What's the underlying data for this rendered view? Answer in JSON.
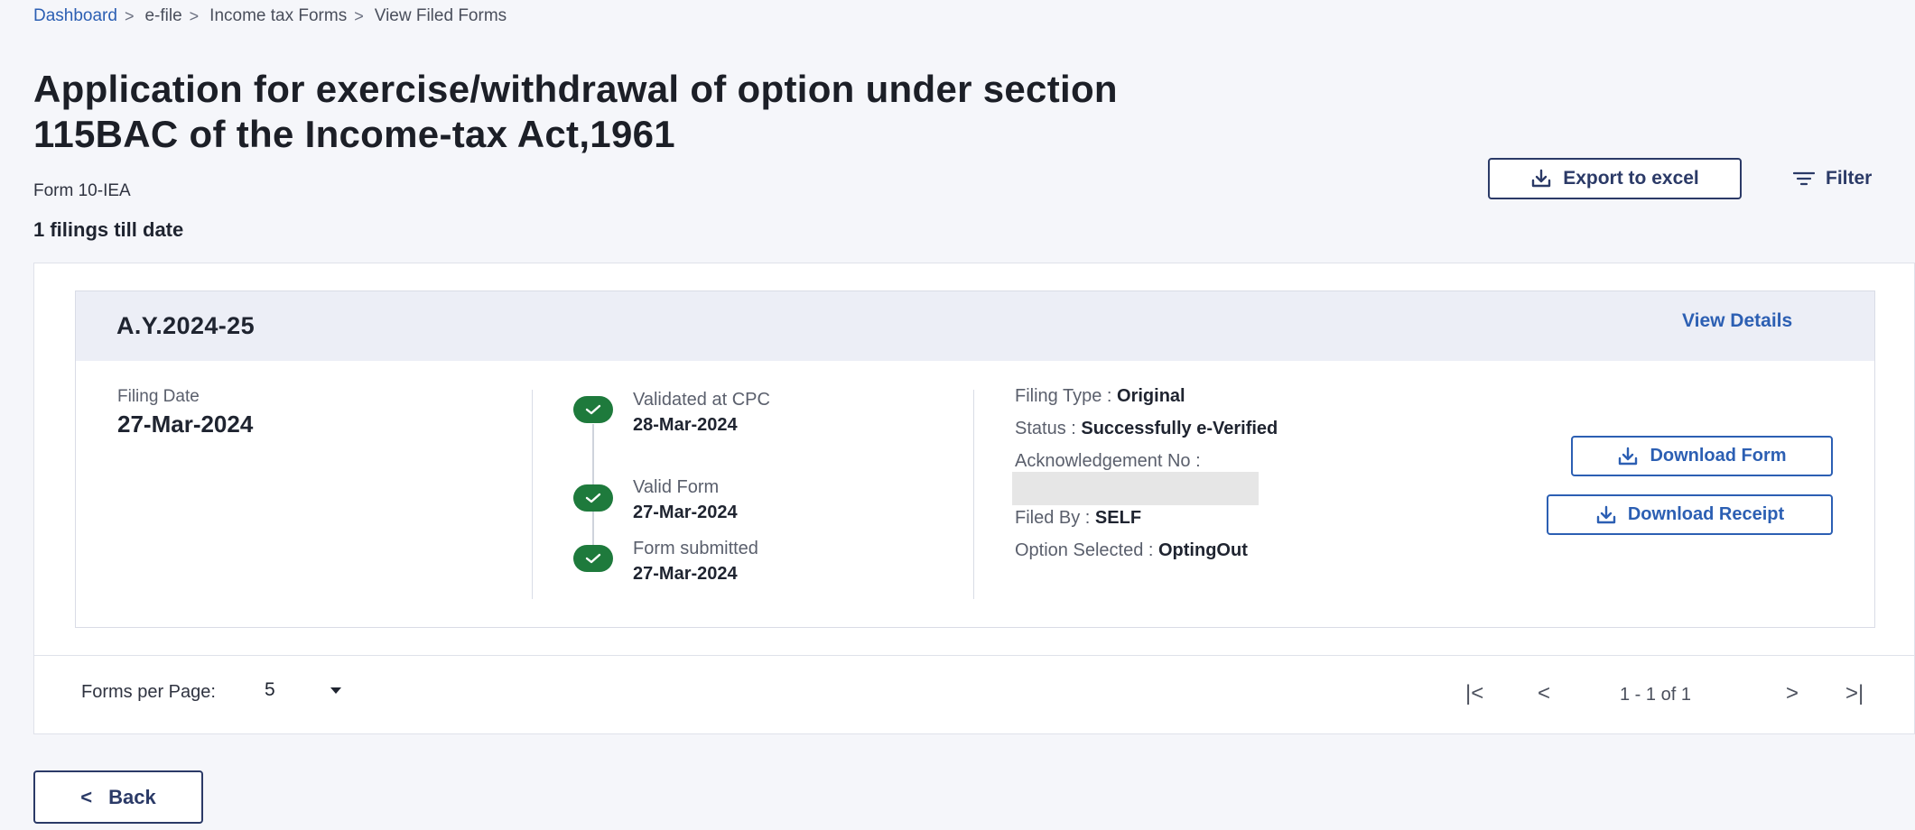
{
  "breadcrumb": {
    "items": [
      "Dashboard",
      "e-file",
      "Income tax Forms",
      "View Filed Forms"
    ],
    "separator": ">"
  },
  "page": {
    "title": "Application for exercise/withdrawal of option under section 115BAC of the Income-tax Act,1961",
    "form_name": "Form 10-IEA",
    "filings_count": "1 filings till date"
  },
  "toolbar": {
    "export_label": "Export to excel",
    "filter_label": "Filter"
  },
  "card": {
    "assessment_year": "A.Y.2024-25",
    "view_details_label": "View Details",
    "filing_date_label": "Filing Date",
    "filing_date_value": "27-Mar-2024",
    "timeline": [
      {
        "label": "Validated at CPC",
        "date": "28-Mar-2024"
      },
      {
        "label": "Valid Form",
        "date": "27-Mar-2024"
      },
      {
        "label": "Form submitted",
        "date": "27-Mar-2024"
      }
    ],
    "details": {
      "filing_type_label": "Filing Type :",
      "filing_type_value": "Original",
      "status_label": "Status :",
      "status_value": "Successfully e-Verified",
      "ack_label": "Acknowledgement No :",
      "filed_by_label": "Filed By :",
      "filed_by_value": "SELF",
      "option_label": "Option Selected :",
      "option_value": "OptingOut"
    },
    "download_form_label": "Download Form",
    "download_receipt_label": "Download Receipt"
  },
  "pagination": {
    "per_page_label": "Forms per Page:",
    "per_page_value": "5",
    "first": "|<",
    "prev": "<",
    "range": "1 - 1 of 1",
    "next": ">",
    "last": ">|"
  },
  "back_label": "Back",
  "colors": {
    "accent": "#2c5fb3",
    "navy": "#2b3a67",
    "success": "#1e7a3c",
    "background": "#f5f6fa"
  }
}
